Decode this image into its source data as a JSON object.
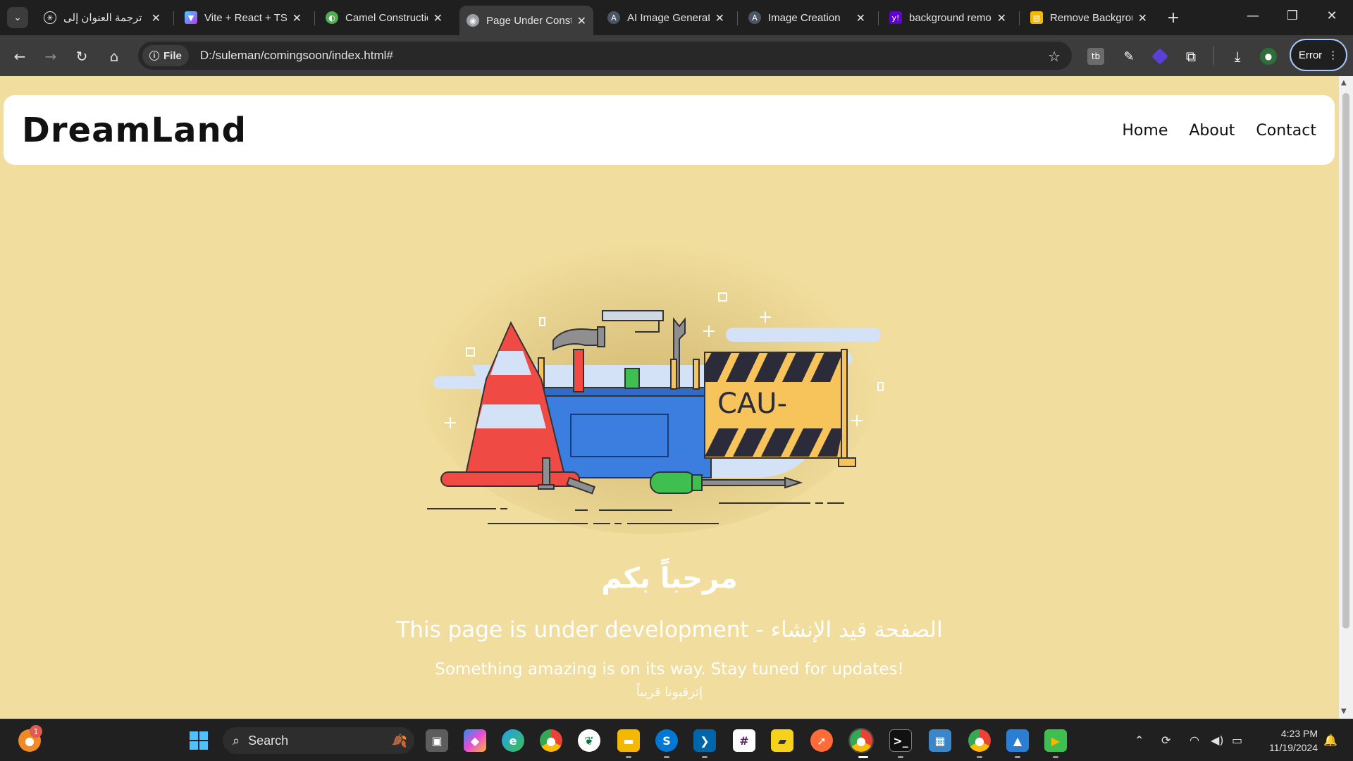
{
  "browser": {
    "tabs": [
      {
        "title": "ترجمة العنوان إلى",
        "favicon": "openai-icon",
        "color": "#e3e3e3"
      },
      {
        "title": "Vite + React + TS",
        "favicon": "vite-icon",
        "color": "#a855f7"
      },
      {
        "title": "Camel Construction",
        "favicon": "globe-green-icon",
        "color": "#4caf50"
      },
      {
        "title": "Page Under Construction",
        "favicon": "globe-icon",
        "color": "#9aa0a6",
        "active": true
      },
      {
        "title": "AI Image Generator",
        "favicon": "ai-icon",
        "color": "#6b7280"
      },
      {
        "title": "Image Creation",
        "favicon": "ai-icon",
        "color": "#6b7280"
      },
      {
        "title": "background remover",
        "favicon": "yahoo-icon",
        "color": "#6001d2"
      },
      {
        "title": "Remove Background",
        "favicon": "remove-bg-icon",
        "color": "#f5b800"
      }
    ],
    "address": {
      "chip": "File",
      "url": "D:/suleman/comingsoon/index.html#"
    },
    "profile_button": "Error"
  },
  "page": {
    "brand": "DreamLand",
    "nav": [
      "Home",
      "About",
      "Contact"
    ],
    "illustration_label": "CAU-",
    "headline_ar": "مرحباً بكم",
    "headline": "This page is under development - الصفحة قيد الإنشاء",
    "sub": "Something amazing is on its way. Stay tuned for updates!",
    "sub_ar": "إترقبونا قريباً"
  },
  "taskbar": {
    "search_placeholder": "Search",
    "notification_count": "1",
    "time": "4:23 PM",
    "date": "11/19/2024"
  },
  "colors": {
    "page_bg": "#f1dd9d",
    "cone_red": "#ef4a43",
    "toolbox_blue": "#3c7de0",
    "barrier_yellow": "#f7c35b",
    "cloud_blue": "#d4e2f8"
  }
}
